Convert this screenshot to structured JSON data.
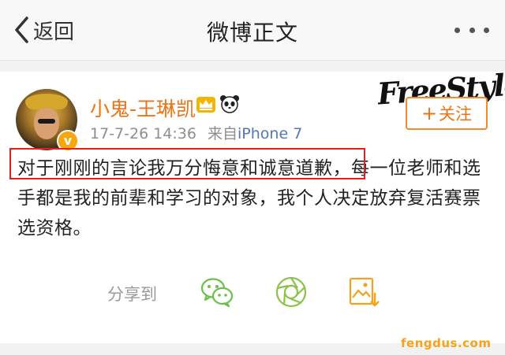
{
  "nav": {
    "back_label": "返回",
    "title": "微博正文"
  },
  "post": {
    "username": "小鬼-王琳凯",
    "timestamp": "17-7-26 14:36",
    "source_label": "来自",
    "source_device": "iPhone 7",
    "follow_label": "关注",
    "verified_badge": "v",
    "highlighted_text": "对于刚刚的言论我万分悔意和诚意道歉",
    "rest_text": "，每一位老师和选手都是我的前辈和学习的对象，我个人决定放弃复活赛票选资格。"
  },
  "share": {
    "label": "分享到",
    "targets": [
      "wechat-icon",
      "moments-icon",
      "save-image-icon"
    ]
  },
  "watermarks": {
    "logo_text": "FreeStyle",
    "site": "fengdus.com"
  },
  "colors": {
    "accent_orange": "#f07213",
    "link_blue": "#5278b6",
    "highlight_red": "#dd2222",
    "share_green": "#6bc04b"
  }
}
